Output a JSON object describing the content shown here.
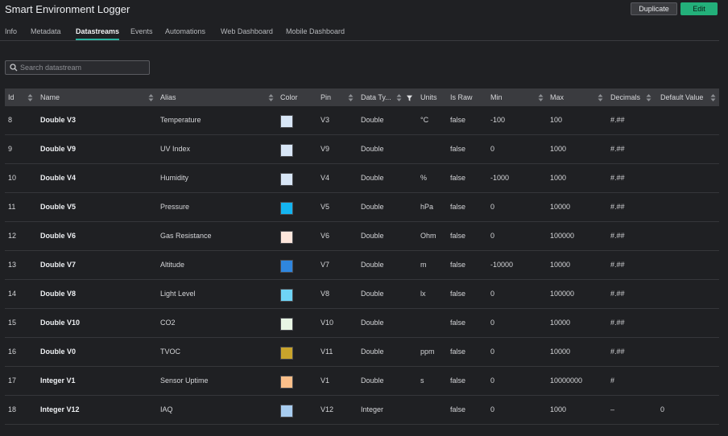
{
  "header": {
    "title": "Smart Environment Logger",
    "duplicate_label": "Duplicate",
    "edit_label": "Edit"
  },
  "tabs": [
    "Info",
    "Metadata",
    "Datastreams",
    "Events",
    "Automations",
    "Web Dashboard",
    "Mobile Dashboard"
  ],
  "active_tab": "Datastreams",
  "search": {
    "placeholder": "Search datastream"
  },
  "columns": [
    "Id",
    "Name",
    "Alias",
    "Color",
    "Pin",
    "Data Ty...",
    "Units",
    "Is Raw",
    "Min",
    "Max",
    "Decimals",
    "Default Value"
  ],
  "rows": [
    {
      "id": "8",
      "name": "Double V3",
      "alias": "Temperature",
      "color": "#d8e6f6",
      "pin": "V3",
      "type": "Double",
      "units": "°C",
      "raw": "false",
      "min": "-100",
      "max": "100",
      "decimals": "#.##",
      "default": ""
    },
    {
      "id": "9",
      "name": "Double V9",
      "alias": "UV Index",
      "color": "#d8e6f6",
      "pin": "V9",
      "type": "Double",
      "units": "",
      "raw": "false",
      "min": "0",
      "max": "1000",
      "decimals": "#.##",
      "default": ""
    },
    {
      "id": "10",
      "name": "Double V4",
      "alias": "Humidity",
      "color": "#d8e6f6",
      "pin": "V4",
      "type": "Double",
      "units": "%",
      "raw": "false",
      "min": "-1000",
      "max": "1000",
      "decimals": "#.##",
      "default": ""
    },
    {
      "id": "11",
      "name": "Double V5",
      "alias": "Pressure",
      "color": "#14b4f0",
      "pin": "V5",
      "type": "Double",
      "units": "hPa",
      "raw": "false",
      "min": "0",
      "max": "10000",
      "decimals": "#.##",
      "default": ""
    },
    {
      "id": "12",
      "name": "Double V6",
      "alias": "Gas Resistance",
      "color": "#fde6dc",
      "pin": "V6",
      "type": "Double",
      "units": "Ohm",
      "raw": "false",
      "min": "0",
      "max": "100000",
      "decimals": "#.##",
      "default": ""
    },
    {
      "id": "13",
      "name": "Double V7",
      "alias": "Altitude",
      "color": "#2f86de",
      "pin": "V7",
      "type": "Double",
      "units": "m",
      "raw": "false",
      "min": "-10000",
      "max": "10000",
      "decimals": "#.##",
      "default": ""
    },
    {
      "id": "14",
      "name": "Double V8",
      "alias": "Light Level",
      "color": "#6fd4f6",
      "pin": "V8",
      "type": "Double",
      "units": "lx",
      "raw": "false",
      "min": "0",
      "max": "100000",
      "decimals": "#.##",
      "default": ""
    },
    {
      "id": "15",
      "name": "Double V10",
      "alias": "CO2",
      "color": "#e8f6e4",
      "pin": "V10",
      "type": "Double",
      "units": "",
      "raw": "false",
      "min": "0",
      "max": "10000",
      "decimals": "#.##",
      "default": ""
    },
    {
      "id": "16",
      "name": "Double V0",
      "alias": "TVOC",
      "color": "#c9a42c",
      "pin": "V11",
      "type": "Double",
      "units": "ppm",
      "raw": "false",
      "min": "0",
      "max": "10000",
      "decimals": "#.##",
      "default": ""
    },
    {
      "id": "17",
      "name": "Integer V1",
      "alias": "Sensor Uptime",
      "color": "#fbbf8a",
      "pin": "V1",
      "type": "Double",
      "units": "s",
      "raw": "false",
      "min": "0",
      "max": "10000000",
      "decimals": "#",
      "default": ""
    },
    {
      "id": "18",
      "name": "Integer V12",
      "alias": "IAQ",
      "color": "#a8cdf0",
      "pin": "V12",
      "type": "Integer",
      "units": "",
      "raw": "false",
      "min": "0",
      "max": "1000",
      "decimals": "–",
      "default": "0"
    }
  ],
  "colors": {
    "accent": "#23b07a",
    "tab_underline": "#2bb3a0",
    "background": "#1f2023",
    "header_bg": "#3a3b3f"
  }
}
